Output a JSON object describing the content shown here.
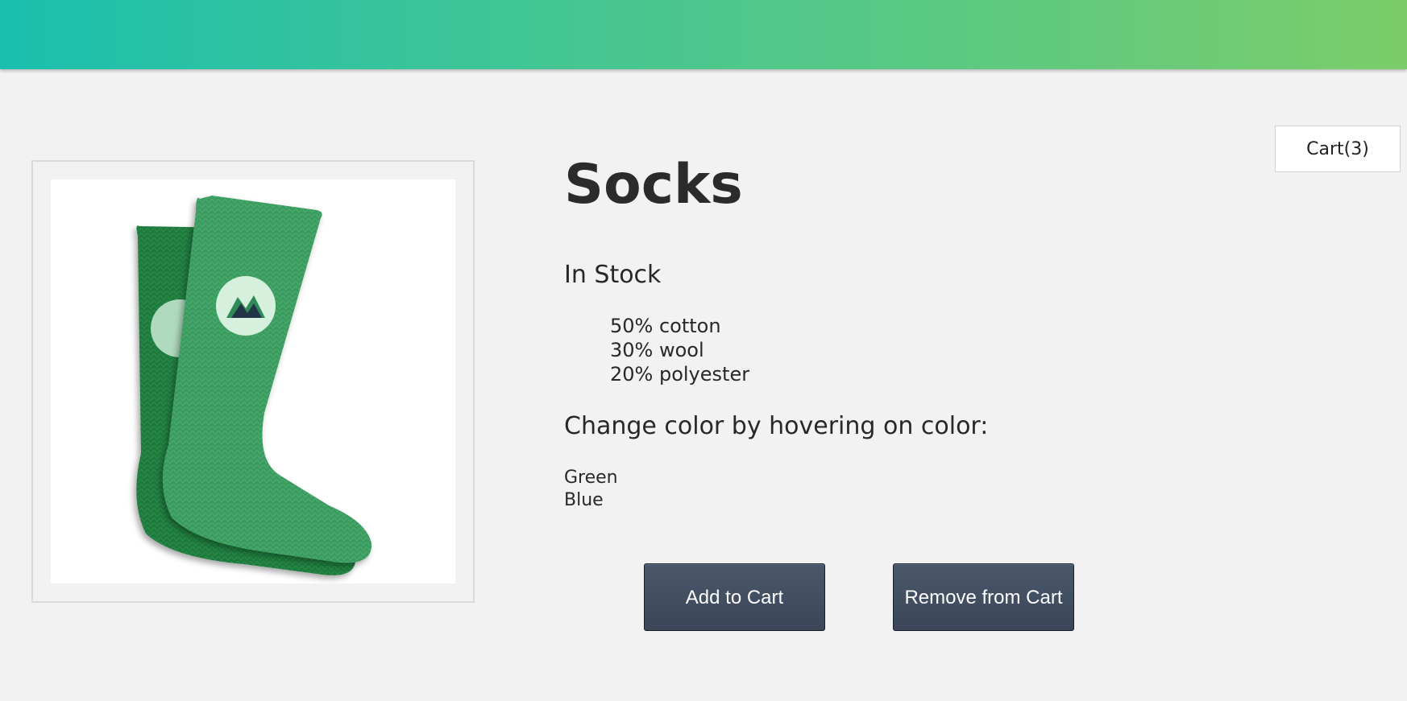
{
  "header": {
    "gradient_start": "#1bbfae",
    "gradient_end": "#7ccd6a"
  },
  "cart": {
    "label": "Cart(3)"
  },
  "product": {
    "image_icon": "green-sock-image",
    "title": "Socks",
    "stock_status": "In Stock",
    "details": [
      "50% cotton",
      "30% wool",
      "20% polyester"
    ],
    "color_instruction": "Change color by hovering on color:",
    "variants": [
      "Green",
      "Blue"
    ]
  },
  "actions": {
    "add_to_cart": "Add to Cart",
    "remove_from_cart": "Remove from Cart",
    "button_color": "#434f61"
  }
}
